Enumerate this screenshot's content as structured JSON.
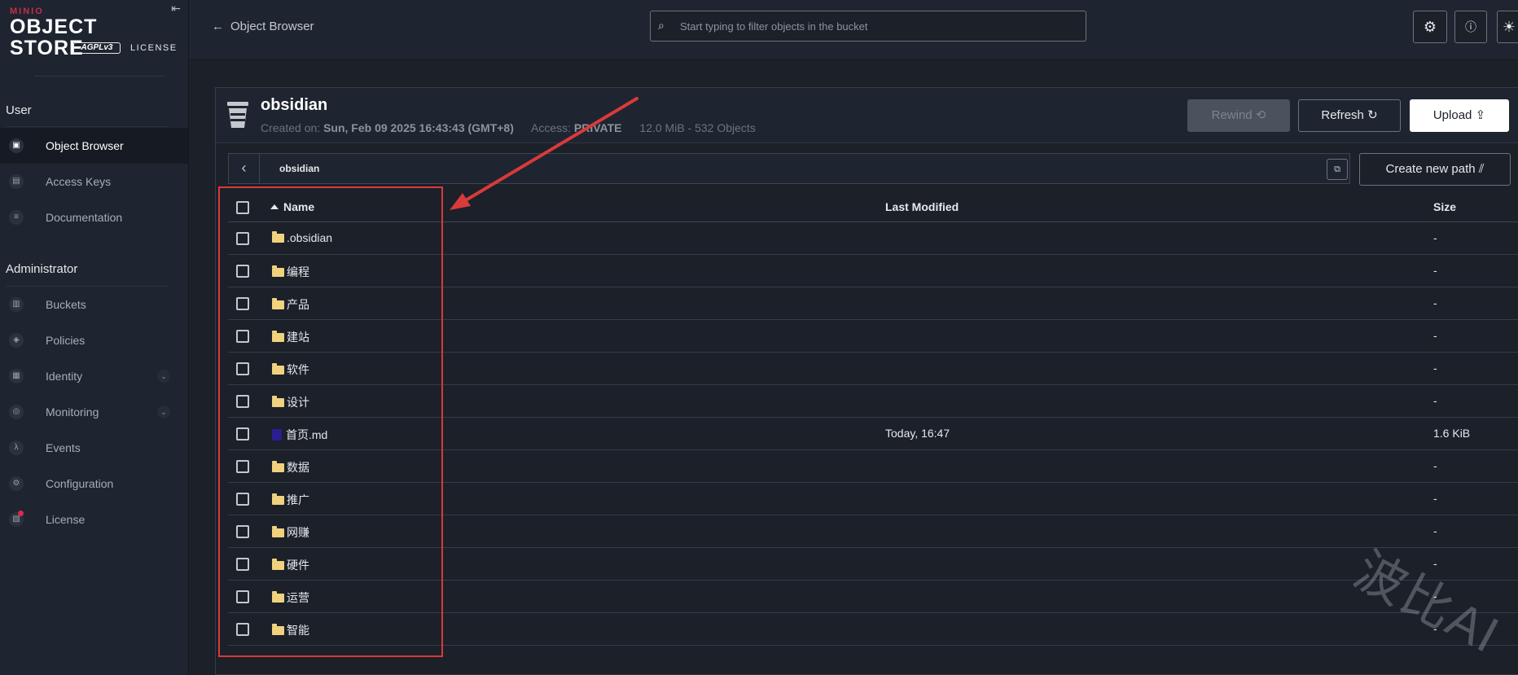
{
  "logo": {
    "brand": "MINIO",
    "product": "OBJECT STORE",
    "license_badge": "AGPLv3",
    "license_text": "LICENSE"
  },
  "sidebar": {
    "sections": [
      {
        "title": "User",
        "items": [
          {
            "label": "Object Browser",
            "icon": "object-browser-icon",
            "active": true
          },
          {
            "label": "Access Keys",
            "icon": "key-icon"
          },
          {
            "label": "Documentation",
            "icon": "document-icon"
          }
        ]
      },
      {
        "title": "Administrator",
        "items": [
          {
            "label": "Buckets",
            "icon": "bucket-icon"
          },
          {
            "label": "Policies",
            "icon": "shield-icon"
          },
          {
            "label": "Identity",
            "icon": "identity-icon",
            "expandable": true
          },
          {
            "label": "Monitoring",
            "icon": "monitor-icon",
            "expandable": true
          },
          {
            "label": "Events",
            "icon": "lambda-icon"
          },
          {
            "label": "Configuration",
            "icon": "gear-icon"
          },
          {
            "label": "License",
            "icon": "license-icon",
            "badge": true
          }
        ]
      }
    ]
  },
  "topbar": {
    "back_label": "Object Browser",
    "search_placeholder": "Start typing to filter objects in the bucket"
  },
  "bucket": {
    "name": "obsidian",
    "created_label": "Created on:",
    "created_value": "Sun, Feb 09 2025 16:43:43 (GMT+8)",
    "access_label": "Access:",
    "access_value": "PRIVATE",
    "usage": "12.0 MiB - 532 Objects"
  },
  "actions": {
    "rewind": "Rewind",
    "refresh": "Refresh",
    "upload": "Upload",
    "create_path": "Create new path"
  },
  "path": {
    "current": "obsidian"
  },
  "table": {
    "headers": {
      "name": "Name",
      "modified": "Last Modified",
      "size": "Size"
    },
    "rows": [
      {
        "name": ".obsidian",
        "type": "folder",
        "modified": "",
        "size": "-"
      },
      {
        "name": "编程",
        "type": "folder",
        "modified": "",
        "size": "-"
      },
      {
        "name": "产品",
        "type": "folder",
        "modified": "",
        "size": "-"
      },
      {
        "name": "建站",
        "type": "folder",
        "modified": "",
        "size": "-"
      },
      {
        "name": "软件",
        "type": "folder",
        "modified": "",
        "size": "-"
      },
      {
        "name": "设计",
        "type": "folder",
        "modified": "",
        "size": "-"
      },
      {
        "name": "首页.md",
        "type": "file",
        "modified": "Today, 16:47",
        "size": "1.6 KiB"
      },
      {
        "name": "数据",
        "type": "folder",
        "modified": "",
        "size": "-"
      },
      {
        "name": "推广",
        "type": "folder",
        "modified": "",
        "size": "-"
      },
      {
        "name": "网赚",
        "type": "folder",
        "modified": "",
        "size": "-"
      },
      {
        "name": "硬件",
        "type": "folder",
        "modified": "",
        "size": "-"
      },
      {
        "name": "运营",
        "type": "folder",
        "modified": "",
        "size": "-"
      },
      {
        "name": "智能",
        "type": "folder",
        "modified": "",
        "size": "-"
      }
    ]
  },
  "watermark": "波比AI",
  "colors": {
    "accent": "#c72c48",
    "annotation": "#d93a3a",
    "background": "#1b2029"
  }
}
